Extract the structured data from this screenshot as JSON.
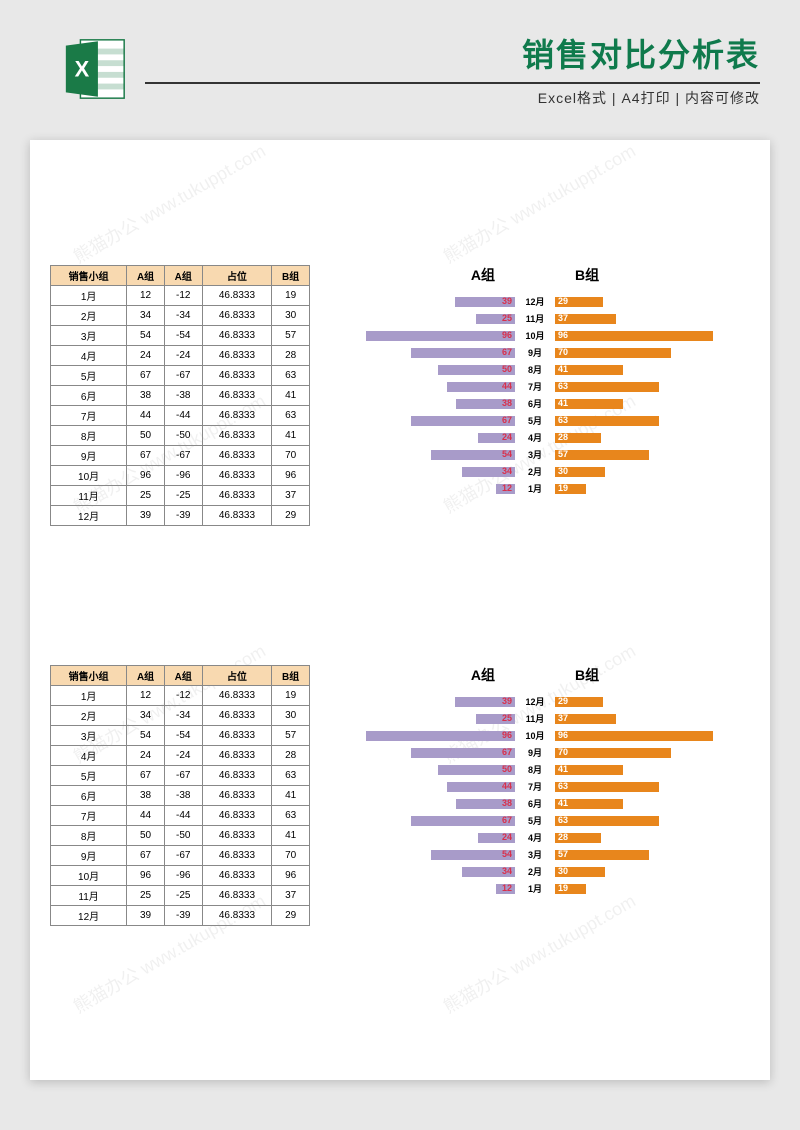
{
  "header": {
    "title": "销售对比分析表",
    "subtitle": "Excel格式 | A4打印 | 内容可修改"
  },
  "watermark": "熊猫办公 www.tukuppt.com",
  "table": {
    "headers": [
      "销售小组",
      "A组",
      "A组",
      "占位",
      "B组"
    ],
    "rows": [
      [
        "1月",
        "12",
        "-12",
        "46.8333",
        "19"
      ],
      [
        "2月",
        "34",
        "-34",
        "46.8333",
        "30"
      ],
      [
        "3月",
        "54",
        "-54",
        "46.8333",
        "57"
      ],
      [
        "4月",
        "24",
        "-24",
        "46.8333",
        "28"
      ],
      [
        "5月",
        "67",
        "-67",
        "46.8333",
        "63"
      ],
      [
        "6月",
        "38",
        "-38",
        "46.8333",
        "41"
      ],
      [
        "7月",
        "44",
        "-44",
        "46.8333",
        "63"
      ],
      [
        "8月",
        "50",
        "-50",
        "46.8333",
        "41"
      ],
      [
        "9月",
        "67",
        "-67",
        "46.8333",
        "70"
      ],
      [
        "10月",
        "96",
        "-96",
        "46.8333",
        "96"
      ],
      [
        "11月",
        "25",
        "-25",
        "46.8333",
        "37"
      ],
      [
        "12月",
        "39",
        "-39",
        "46.8333",
        "29"
      ]
    ]
  },
  "chart_data": {
    "type": "bar",
    "title_a": "A组",
    "title_b": "B组",
    "orientation": "horizontal-diverging",
    "categories": [
      "12月",
      "11月",
      "10月",
      "9月",
      "8月",
      "7月",
      "6月",
      "5月",
      "4月",
      "3月",
      "2月",
      "1月"
    ],
    "series": [
      {
        "name": "A组",
        "color": "#a89bc9",
        "values": [
          39,
          25,
          96,
          67,
          50,
          44,
          38,
          67,
          24,
          54,
          34,
          12
        ]
      },
      {
        "name": "B组",
        "color": "#e8861c",
        "values": [
          29,
          37,
          96,
          70,
          41,
          63,
          41,
          63,
          28,
          57,
          30,
          19
        ]
      }
    ],
    "max_scale": 100
  }
}
